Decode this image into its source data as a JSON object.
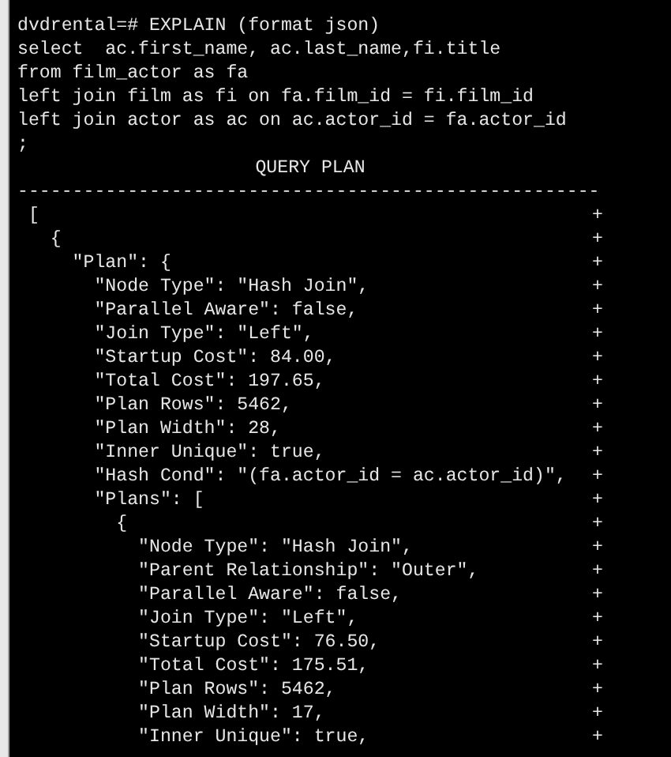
{
  "command": [
    "dvdrental=# EXPLAIN (format json)",
    "select  ac.first_name, ac.last_name,fi.title",
    "from film_actor as fa",
    "left join film as fi on fa.film_id = fi.film_id",
    "left join actor as ac on ac.actor_id = fa.actor_id",
    ";"
  ],
  "result": {
    "column_header": "QUERY PLAN",
    "separator": "-----------------------------------------------------",
    "rows": [
      {
        "text": " [",
        "mark": "+"
      },
      {
        "text": "   {",
        "mark": "+"
      },
      {
        "text": "     \"Plan\": {",
        "mark": "+"
      },
      {
        "text": "       \"Node Type\": \"Hash Join\",",
        "mark": "+"
      },
      {
        "text": "       \"Parallel Aware\": false,",
        "mark": "+"
      },
      {
        "text": "       \"Join Type\": \"Left\",",
        "mark": "+"
      },
      {
        "text": "       \"Startup Cost\": 84.00,",
        "mark": "+"
      },
      {
        "text": "       \"Total Cost\": 197.65,",
        "mark": "+"
      },
      {
        "text": "       \"Plan Rows\": 5462,",
        "mark": "+"
      },
      {
        "text": "       \"Plan Width\": 28,",
        "mark": "+"
      },
      {
        "text": "       \"Inner Unique\": true,",
        "mark": "+"
      },
      {
        "text": "       \"Hash Cond\": \"(fa.actor_id = ac.actor_id)\",",
        "mark": "+"
      },
      {
        "text": "       \"Plans\": [",
        "mark": "+"
      },
      {
        "text": "         {",
        "mark": "+"
      },
      {
        "text": "           \"Node Type\": \"Hash Join\",",
        "mark": "+"
      },
      {
        "text": "           \"Parent Relationship\": \"Outer\",",
        "mark": "+"
      },
      {
        "text": "           \"Parallel Aware\": false,",
        "mark": "+"
      },
      {
        "text": "           \"Join Type\": \"Left\",",
        "mark": "+"
      },
      {
        "text": "           \"Startup Cost\": 76.50,",
        "mark": "+"
      },
      {
        "text": "           \"Total Cost\": 175.51,",
        "mark": "+"
      },
      {
        "text": "           \"Plan Rows\": 5462,",
        "mark": "+"
      },
      {
        "text": "           \"Plan Width\": 17,",
        "mark": "+"
      },
      {
        "text": "           \"Inner Unique\": true,",
        "mark": "+"
      }
    ]
  }
}
